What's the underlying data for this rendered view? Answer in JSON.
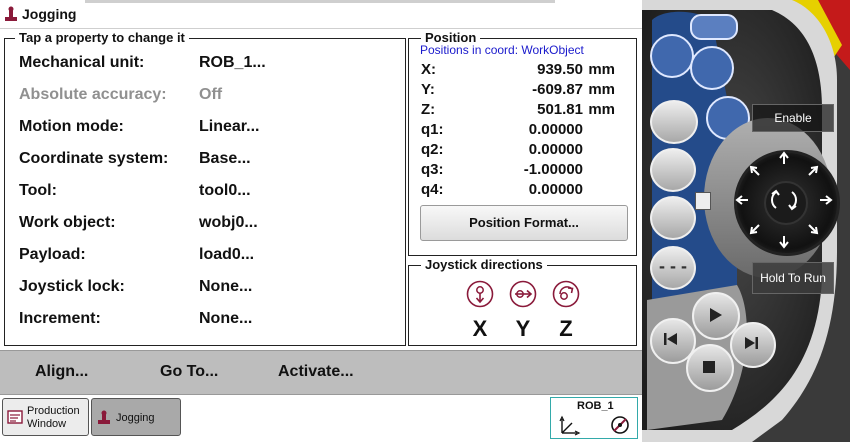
{
  "window": {
    "title": "Jogging"
  },
  "properties": {
    "group_title": "Tap a property to change it",
    "rows": [
      {
        "label": "Mechanical unit:",
        "value": "ROB_1...",
        "enabled": true
      },
      {
        "label": "Absolute accuracy:",
        "value": "Off",
        "enabled": false
      },
      {
        "label": "Motion mode:",
        "value": "Linear...",
        "enabled": true
      },
      {
        "label": "Coordinate system:",
        "value": "Base...",
        "enabled": true
      },
      {
        "label": "Tool:",
        "value": "tool0...",
        "enabled": true
      },
      {
        "label": "Work object:",
        "value": "wobj0...",
        "enabled": true
      },
      {
        "label": "Payload:",
        "value": "load0...",
        "enabled": true
      },
      {
        "label": "Joystick lock:",
        "value": "None...",
        "enabled": true
      },
      {
        "label": "Increment:",
        "value": "None...",
        "enabled": true
      }
    ]
  },
  "position": {
    "group_title": "Position",
    "subtitle": "Positions in coord: WorkObject",
    "rows": [
      {
        "label": "X:",
        "value": "939.50",
        "unit": "mm"
      },
      {
        "label": "Y:",
        "value": "-609.87",
        "unit": "mm"
      },
      {
        "label": "Z:",
        "value": "501.81",
        "unit": "mm"
      },
      {
        "label": "q1:",
        "value": "0.00000",
        "unit": ""
      },
      {
        "label": "q2:",
        "value": "0.00000",
        "unit": ""
      },
      {
        "label": "q3:",
        "value": "-1.00000",
        "unit": ""
      },
      {
        "label": "q4:",
        "value": "0.00000",
        "unit": ""
      }
    ],
    "format_button": "Position Format..."
  },
  "joystick": {
    "group_title": "Joystick directions",
    "axes": [
      "X",
      "Y",
      "Z"
    ]
  },
  "commands": {
    "align": "Align...",
    "goto": "Go To...",
    "activate": "Activate..."
  },
  "taskbar": {
    "production_window_line1": "Production",
    "production_window_line2": "Window",
    "jogging": "Jogging",
    "mech_unit": "ROB_1"
  },
  "pendant": {
    "enable_label": "Enable",
    "hold_to_run_label": "Hold To Run"
  },
  "colors": {
    "accent_maroon": "#8a1a3a",
    "link_blue": "#1a1acc",
    "command_bar": "#bdbdbd",
    "pendant_blue": "#2f5a9e"
  }
}
